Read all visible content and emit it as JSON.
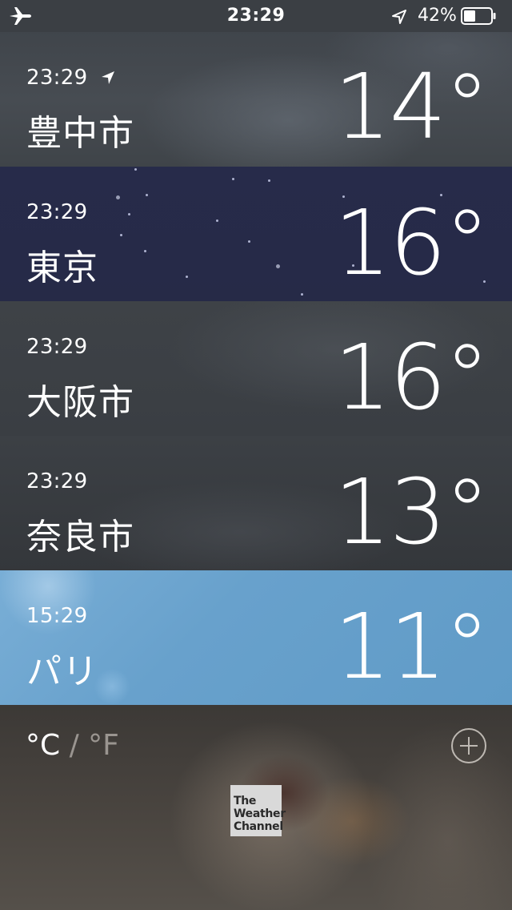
{
  "status_bar": {
    "time": "23:29",
    "battery_percent": "42%",
    "battery_level": 0.42
  },
  "cities": [
    {
      "time": "23:29",
      "name": "豊中市",
      "temp": "14°",
      "current_location": true
    },
    {
      "time": "23:29",
      "name": "東京",
      "temp": "16°",
      "current_location": false
    },
    {
      "time": "23:29",
      "name": "大阪市",
      "temp": "16°",
      "current_location": false
    },
    {
      "time": "23:29",
      "name": "奈良市",
      "temp": "13°",
      "current_location": false
    },
    {
      "time": "15:29",
      "name": "パリ",
      "temp": "11°",
      "current_location": false
    }
  ],
  "footer": {
    "unit_c": "°C",
    "unit_sep": " / ",
    "unit_f": "°F",
    "logo_line1": "The",
    "logo_line2": "Weather",
    "logo_line3": "Channel"
  },
  "icons": {
    "airplane": "airplane-icon",
    "location": "location-arrow-icon",
    "battery": "battery-icon",
    "add": "plus-circle-icon"
  }
}
